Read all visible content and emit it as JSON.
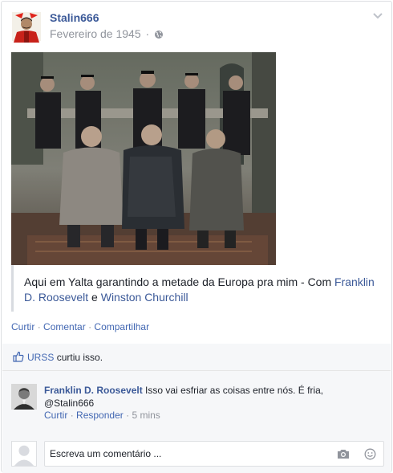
{
  "post": {
    "author": "Stalin666",
    "date": "Fevereiro de 1945",
    "separator": "·",
    "icons": {
      "audience": "globe-icon",
      "menu": "chevron-down-icon"
    },
    "text_prefix": "Aqui em Yalta garantindo a metade da Europa pra mim - Com",
    "tag1": "Franklin D. Roosevelt",
    "conj": "e",
    "tag2": "Winston Churchill"
  },
  "actions": {
    "like": "Curtir",
    "comment": "Comentar",
    "share": "Compartilhar",
    "dot": "·"
  },
  "likes": {
    "who": "URSS",
    "text": "curtiu isso.",
    "icon": "thumbs-up-icon"
  },
  "comment": {
    "author": "Franklin D. Roosevelt",
    "text": "Isso vai esfriar as coisas entre nós. É fria, @Stalin666",
    "like": "Curtir",
    "reply": "Responder",
    "time": "5 mins",
    "dot": "·"
  },
  "composer": {
    "placeholder": "Escreva um comentário ...",
    "icons": [
      "camera-icon",
      "smiley-icon"
    ]
  },
  "colors": {
    "link": "#3b5998",
    "action": "#4267b2",
    "muted": "#90949c",
    "bar_bg": "#f6f7f9",
    "border": "#dddfe2"
  }
}
